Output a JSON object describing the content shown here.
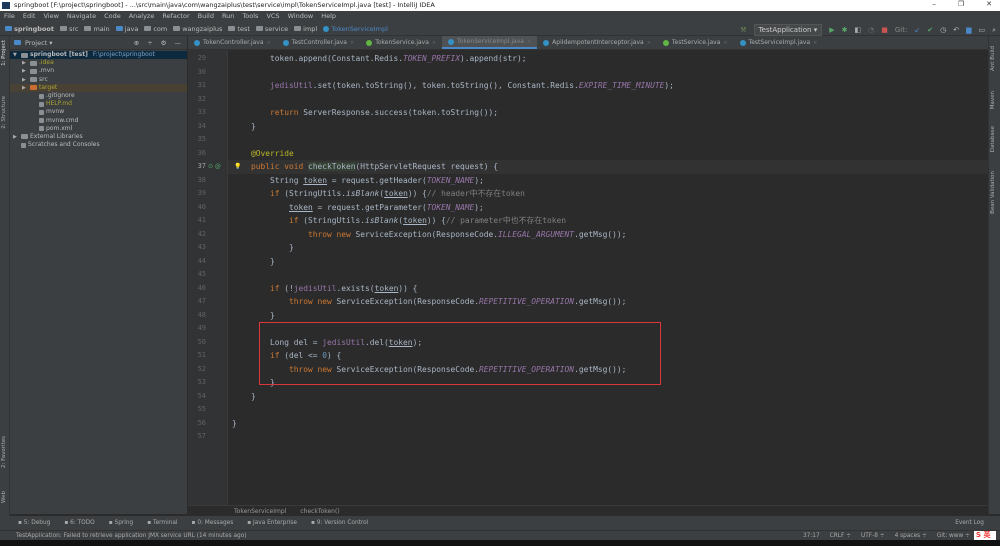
{
  "window": {
    "title": "springboot [F:\\project\\springboot] - ...\\src\\main\\java\\com\\wangzaiplus\\test\\service\\impl\\TokenServiceImpl.java [test] - IntelliJ IDEA",
    "controls": [
      "–",
      "❐",
      "✕"
    ]
  },
  "menu": [
    "File",
    "Edit",
    "View",
    "Navigate",
    "Code",
    "Analyze",
    "Refactor",
    "Build",
    "Run",
    "Tools",
    "VCS",
    "Window",
    "Help"
  ],
  "breadcrumb": [
    "springboot",
    "src",
    "main",
    "java",
    "com",
    "wangzaiplus",
    "test",
    "service",
    "impl",
    "TokenServiceImpl"
  ],
  "toolbar": {
    "run_config": "TestApplication ▾",
    "git_label": "Git:"
  },
  "left_stripe": [
    "1: Project",
    "2: Structure",
    "2: Favorites",
    "Web"
  ],
  "right_stripe": [
    "Ant Build",
    "Maven",
    "Database",
    "Bean Validation"
  ],
  "project": {
    "title": "Project ▾",
    "tree": [
      {
        "label": "springboot [test]",
        "extra": "F:\\project\\springboot",
        "level": 0,
        "arrow": "▼",
        "color": "#bbb",
        "sel": true
      },
      {
        "label": ".idea",
        "level": 1,
        "arrow": "▶",
        "color": "#a8a32e"
      },
      {
        "label": ".mvn",
        "level": 1,
        "arrow": "▶",
        "color": "#bbb"
      },
      {
        "label": "src",
        "level": 1,
        "arrow": "▶",
        "color": "#bbb"
      },
      {
        "label": "target",
        "level": 1,
        "arrow": "▶",
        "color": "#a8a32e",
        "hl": true
      },
      {
        "label": ".gitignore",
        "level": 2,
        "arrow": "",
        "color": "#bbb"
      },
      {
        "label": "HELP.md",
        "level": 2,
        "arrow": "",
        "color": "#a8a32e"
      },
      {
        "label": "mvnw",
        "level": 2,
        "arrow": "",
        "color": "#bbb"
      },
      {
        "label": "mvnw.cmd",
        "level": 2,
        "arrow": "",
        "color": "#bbb"
      },
      {
        "label": "pom.xml",
        "level": 2,
        "arrow": "",
        "color": "#bbb"
      },
      {
        "label": "External Libraries",
        "level": 0,
        "arrow": "▶",
        "color": "#bbb"
      },
      {
        "label": "Scratches and Consoles",
        "level": 0,
        "arrow": "",
        "color": "#bbb"
      }
    ]
  },
  "tabs": [
    {
      "label": "TokenController.java",
      "type": "class"
    },
    {
      "label": "TestController.java",
      "type": "class"
    },
    {
      "label": "TokenService.java",
      "type": "interface"
    },
    {
      "label": "TokenServiceImpl.java",
      "type": "class",
      "active": true
    },
    {
      "label": "ApiIdempotentInterceptor.java",
      "type": "class"
    },
    {
      "label": "TestService.java",
      "type": "interface"
    },
    {
      "label": "TestServiceImpl.java",
      "type": "class"
    }
  ],
  "editor": {
    "first_line": 29,
    "current_line": 37,
    "lines": [
      [
        [
          2,
          ""
        ],
        [
          "token.append(Constant.Redis.",
          ""
        ],
        [
          "TOKEN_PREFIX",
          "it"
        ],
        [
          ").append(str);",
          ""
        ]
      ],
      [],
      [
        [
          2,
          ""
        ],
        [
          "jedisUtil",
          "fld"
        ],
        [
          ".set(token.toString(), token.toString(), Constant.Redis.",
          ""
        ],
        [
          "EXPIRE_TIME_MINUTE",
          "it"
        ],
        [
          ");",
          ""
        ]
      ],
      [],
      [
        [
          2,
          ""
        ],
        [
          "return ",
          "kw"
        ],
        [
          "ServerResponse.success(token.toString());",
          ""
        ]
      ],
      [
        [
          1,
          ""
        ],
        [
          "}",
          ""
        ]
      ],
      [],
      [
        [
          1,
          ""
        ],
        [
          "@Override",
          "ann"
        ]
      ],
      [
        [
          1,
          ""
        ],
        [
          "public void ",
          "kw"
        ],
        [
          "checkToken",
          "mth"
        ],
        [
          "(HttpServletRequest request) {",
          ""
        ]
      ],
      [
        [
          2,
          ""
        ],
        [
          "String ",
          ""
        ],
        [
          "token",
          "ul"
        ],
        [
          " = request.getHeader(",
          ""
        ],
        [
          "TOKEN_NAME",
          "it"
        ],
        [
          ");",
          ""
        ]
      ],
      [
        [
          2,
          ""
        ],
        [
          "if ",
          "kw"
        ],
        [
          "(StringUtils.",
          ""
        ],
        [
          "isBlank",
          "sm"
        ],
        [
          "(",
          ""
        ],
        [
          "token",
          "ul"
        ],
        [
          ")) {",
          ""
        ],
        [
          "// header中不存在token",
          "cm"
        ]
      ],
      [
        [
          3,
          ""
        ],
        [
          "token",
          "ul"
        ],
        [
          " = request.getParameter(",
          ""
        ],
        [
          "TOKEN_NAME",
          "it"
        ],
        [
          ");",
          ""
        ]
      ],
      [
        [
          3,
          ""
        ],
        [
          "if ",
          "kw"
        ],
        [
          "(StringUtils.",
          ""
        ],
        [
          "isBlank",
          "sm"
        ],
        [
          "(",
          ""
        ],
        [
          "token",
          "ul"
        ],
        [
          ")) {",
          ""
        ],
        [
          "// parameter中也不存在token",
          "cm"
        ]
      ],
      [
        [
          4,
          ""
        ],
        [
          "throw new ",
          "kw"
        ],
        [
          "ServiceException(ResponseCode.",
          ""
        ],
        [
          "ILLEGAL_ARGUMENT",
          "it"
        ],
        [
          ".getMsg());",
          ""
        ]
      ],
      [
        [
          3,
          ""
        ],
        [
          "}",
          ""
        ]
      ],
      [
        [
          2,
          ""
        ],
        [
          "}",
          ""
        ]
      ],
      [],
      [
        [
          2,
          ""
        ],
        [
          "if ",
          "kw"
        ],
        [
          "(!",
          ""
        ],
        [
          "jedisUtil",
          "fld"
        ],
        [
          ".exists(",
          ""
        ],
        [
          "token",
          "ul"
        ],
        [
          ")) {",
          ""
        ]
      ],
      [
        [
          3,
          ""
        ],
        [
          "throw new ",
          "kw"
        ],
        [
          "ServiceException(ResponseCode.",
          ""
        ],
        [
          "REPETITIVE_OPERATION",
          "it"
        ],
        [
          ".getMsg());",
          ""
        ]
      ],
      [
        [
          2,
          ""
        ],
        [
          "}",
          ""
        ]
      ],
      [],
      [
        [
          2,
          ""
        ],
        [
          "Long del = ",
          ""
        ],
        [
          "jedisUtil",
          "fld"
        ],
        [
          ".del(",
          ""
        ],
        [
          "token",
          "ul"
        ],
        [
          ");",
          ""
        ]
      ],
      [
        [
          2,
          ""
        ],
        [
          "if ",
          "kw"
        ],
        [
          "(del <= ",
          ""
        ],
        [
          "0",
          "num"
        ],
        [
          ") {",
          ""
        ]
      ],
      [
        [
          3,
          ""
        ],
        [
          "throw new ",
          "kw"
        ],
        [
          "ServiceException(ResponseCode.",
          ""
        ],
        [
          "REPETITIVE_OPERATION",
          "it"
        ],
        [
          ".getMsg());",
          ""
        ]
      ],
      [
        [
          2,
          ""
        ],
        [
          "}",
          ""
        ]
      ],
      [
        [
          1,
          ""
        ],
        [
          "}",
          ""
        ]
      ],
      [],
      [
        [
          0,
          ""
        ],
        [
          "}",
          ""
        ]
      ],
      []
    ]
  },
  "editor_breadcrumb": [
    "TokenServiceImpl",
    "checkToken()"
  ],
  "tool_windows": [
    "5: Debug",
    "6: TODO",
    "Spring",
    "Terminal",
    "0: Messages",
    "Java Enterprise",
    "9: Version Control"
  ],
  "event_log": "Event Log",
  "status": {
    "message": "TestApplication: Failed to retrieve application JMX service URL (14 minutes ago)",
    "position": "37:17",
    "line_sep": "CRLF ÷",
    "encoding": "UTF-8 ÷",
    "indent": "4 spaces ÷",
    "git": "Git: www ÷"
  },
  "ime": "S 英"
}
